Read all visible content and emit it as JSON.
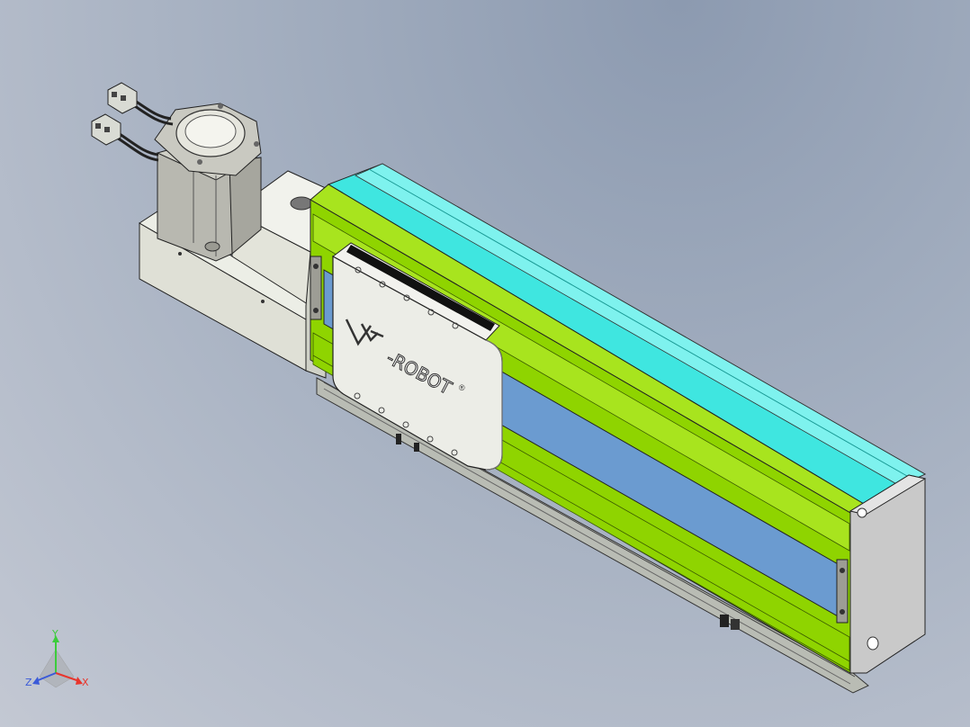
{
  "app": {
    "view_type": "isometric CAD model view"
  },
  "model": {
    "logo_text": "-ROBOT",
    "registered_mark": "®",
    "colors": {
      "body_green": "#8fd400",
      "body_green_light": "#a8e41e",
      "top_rail_cyan": "#3fe6e0",
      "stroke_blue_cover": "#6b9bd0",
      "housing_gray": "#d6d9d0",
      "end_cap_gray": "#c9c9c9",
      "motor_gray": "#b8b8b0"
    }
  },
  "triad": {
    "x_label": "X",
    "y_label": "Y",
    "z_label": "Z",
    "x_color": "#e8352c",
    "y_color": "#3ccc3c",
    "z_color": "#3a5ad8"
  }
}
